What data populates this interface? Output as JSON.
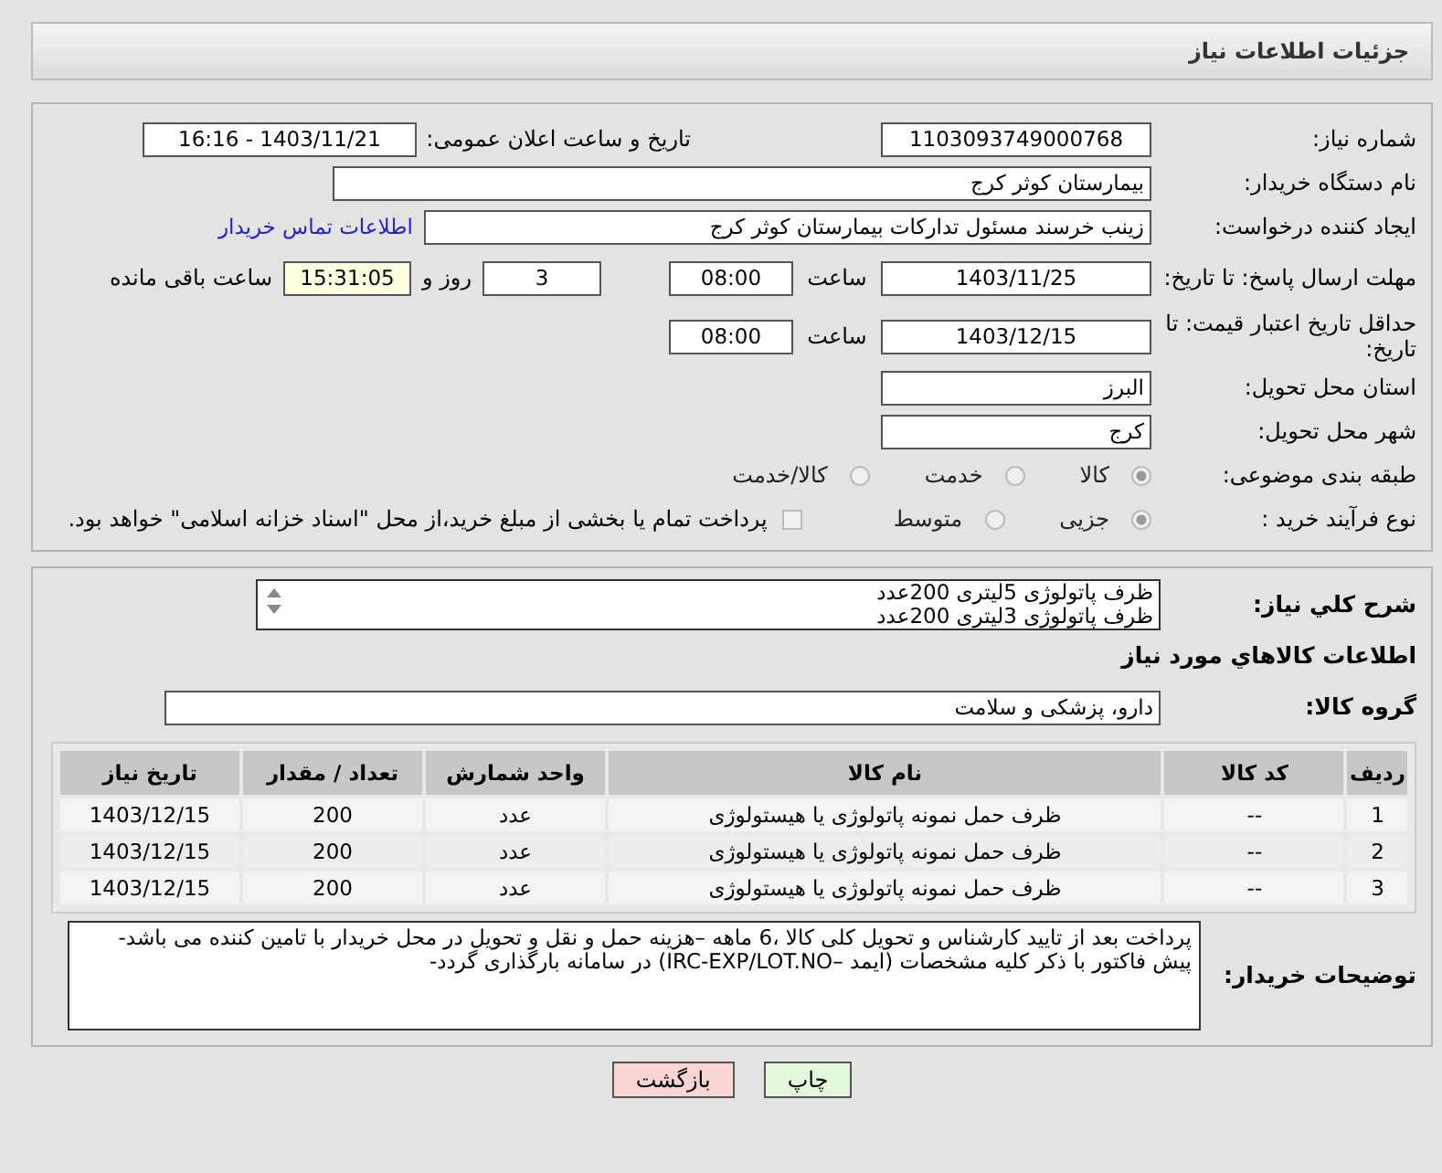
{
  "header": {
    "title": "جزئیات اطلاعات نیاز"
  },
  "need_number": {
    "label": "شماره نیاز:",
    "value": "1103093749000768"
  },
  "announce": {
    "label": "تاریخ و ساعت اعلان عمومی:",
    "value": "1403/11/21 - 16:16"
  },
  "buyer": {
    "label": "نام دستگاه خریدار:",
    "value": "بیمارستان کوثر کرج"
  },
  "requester": {
    "label": "ایجاد کننده درخواست:",
    "value": "زینب خرسند مسئول تداركات بیمارستان کوثر کرج",
    "link": "اطلاعات تماس خریدار"
  },
  "reply_deadline": {
    "label": "مهلت ارسال پاسخ: تا تاریخ:",
    "date": "1403/11/25",
    "time_label": "ساعت",
    "time": "08:00",
    "days": "3",
    "days_label": "روز و",
    "remaining": "15:31:05",
    "remaining_label": "ساعت باقی مانده"
  },
  "price_validity": {
    "label": "حداقل تاریخ اعتبار قیمت: تا تاریخ:",
    "date": "1403/12/15",
    "time_label": "ساعت",
    "time": "08:00"
  },
  "province": {
    "label": "استان محل تحویل:",
    "value": "البرز"
  },
  "city": {
    "label": "شهر محل تحویل:",
    "value": "کرج"
  },
  "category": {
    "label": "طبقه بندی موضوعی:",
    "options": [
      {
        "label": "کالا",
        "selected": true
      },
      {
        "label": "خدمت",
        "selected": false
      },
      {
        "label": "کالا/خدمت",
        "selected": false
      }
    ]
  },
  "purchase_type": {
    "label": "نوع فرآیند خرید :",
    "options": [
      {
        "label": "جزیی",
        "selected": true
      },
      {
        "label": "متوسط",
        "selected": false
      }
    ],
    "payment_checkbox": {
      "label": "پرداخت تمام یا بخشی از مبلغ خرید،از محل \"اسناد خزانه اسلامی\" خواهد بود.",
      "checked": false
    }
  },
  "description": {
    "label": "شرح کلي نياز:",
    "lines": [
      "ظرف پاتولوژی 5لیتری  200عدد",
      "ظرف پاتولوژی 3لیتری  200عدد"
    ]
  },
  "goods_heading": "اطلاعات کالاهاي مورد نياز",
  "goods_group": {
    "label": "گروه کالا:",
    "value": "دارو، پزشکی و سلامت"
  },
  "table": {
    "columns": [
      "ردیف",
      "کد کالا",
      "نام کالا",
      "واحد شمارش",
      "تعداد / مقدار",
      "تاریخ نیاز"
    ],
    "rows": [
      [
        "1",
        "--",
        "ظرف حمل نمونه پاتولوژی یا هیستولوژی",
        "عدد",
        "200",
        "1403/12/15"
      ],
      [
        "2",
        "--",
        "ظرف حمل نمونه پاتولوژی یا هیستولوژی",
        "عدد",
        "200",
        "1403/12/15"
      ],
      [
        "3",
        "--",
        "ظرف حمل نمونه پاتولوژی یا هیستولوژی",
        "عدد",
        "200",
        "1403/12/15"
      ]
    ]
  },
  "buyer_notes": {
    "label": "توضیحات خریدار:",
    "lines": [
      "پرداخت بعد از تایید کارشناس و تحویل کلی کالا ،6 ماهه –هزینه حمل و نقل و تحویل در محل خریدار با تامین کننده می باشد-",
      "پیش فاکتور با ذکر کلیه مشخصات (ایمد –IRC-EXP/LOT.NO) در سامانه بارگذاری گردد-"
    ]
  },
  "buttons": [
    {
      "label": "چاپ",
      "kind": "print"
    },
    {
      "label": "بازگشت",
      "kind": "back"
    }
  ]
}
